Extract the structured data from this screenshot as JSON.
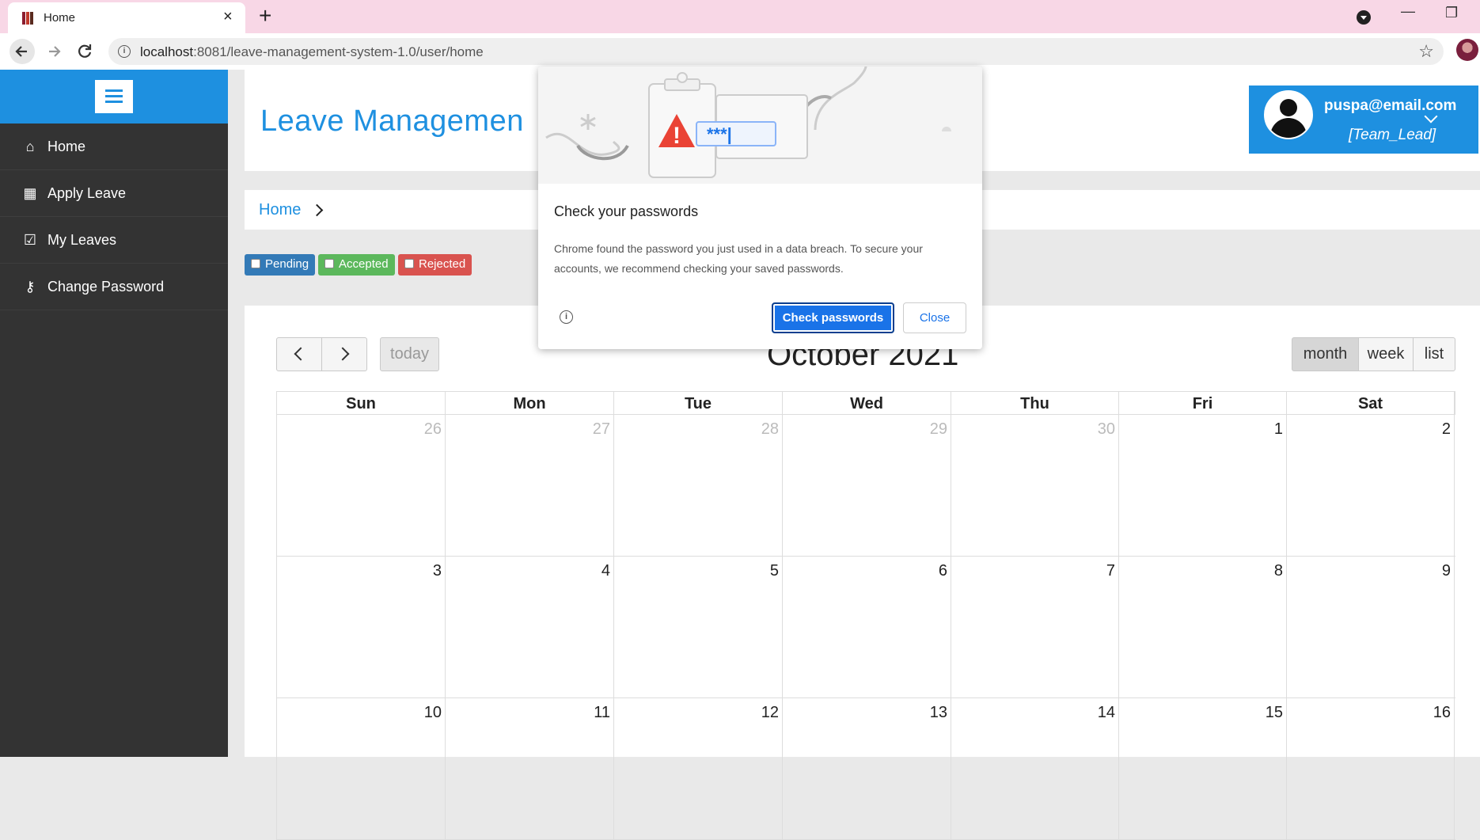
{
  "browser": {
    "tab_title": "Home",
    "tab_close": "×",
    "new_tab": "+",
    "url_host": "localhost",
    "url_rest": ":8081/leave-management-system-1.0/user/home",
    "star": "☆",
    "minimize": "—",
    "restore": "❐"
  },
  "sidebar": {
    "items": [
      {
        "label": "Home",
        "icon": "⌂"
      },
      {
        "label": "Apply Leave",
        "icon": "▦"
      },
      {
        "label": "My Leaves",
        "icon": "☑"
      },
      {
        "label": "Change Password",
        "icon": "⚷"
      }
    ]
  },
  "header": {
    "title": "Leave Managemen",
    "user_email": "puspa@email.com",
    "user_role": "[Team_Lead]"
  },
  "breadcrumb": {
    "home": "Home"
  },
  "filters": [
    {
      "label": "Pending",
      "color": "#337ab7"
    },
    {
      "label": "Accepted",
      "color": "#5cb85c"
    },
    {
      "label": "Rejected",
      "color": "#d9534f"
    }
  ],
  "calendar": {
    "title": "October 2021",
    "today_label": "today",
    "views": [
      "month",
      "week",
      "list"
    ],
    "days": [
      "Sun",
      "Mon",
      "Tue",
      "Wed",
      "Thu",
      "Fri",
      "Sat"
    ],
    "weeks": [
      [
        {
          "n": "26",
          "other": true
        },
        {
          "n": "27",
          "other": true
        },
        {
          "n": "28",
          "other": true
        },
        {
          "n": "29",
          "other": true
        },
        {
          "n": "30",
          "other": true
        },
        {
          "n": "1"
        },
        {
          "n": "2"
        }
      ],
      [
        {
          "n": "3"
        },
        {
          "n": "4"
        },
        {
          "n": "5"
        },
        {
          "n": "6"
        },
        {
          "n": "7"
        },
        {
          "n": "8"
        },
        {
          "n": "9"
        }
      ],
      [
        {
          "n": "10"
        },
        {
          "n": "11"
        },
        {
          "n": "12"
        },
        {
          "n": "13"
        },
        {
          "n": "14"
        },
        {
          "n": "15"
        },
        {
          "n": "16"
        }
      ]
    ]
  },
  "popup": {
    "title": "Check your passwords",
    "body": "Chrome found the password you just used in a data breach. To secure your accounts, we recommend checking your saved passwords.",
    "primary": "Check passwords",
    "secondary": "Close",
    "illus_password": "***|",
    "illus_alert": "!"
  },
  "colors": {
    "accent": "#1e90e0",
    "sidebar_bg": "#333333",
    "chrome_blue": "#1a73e8"
  }
}
